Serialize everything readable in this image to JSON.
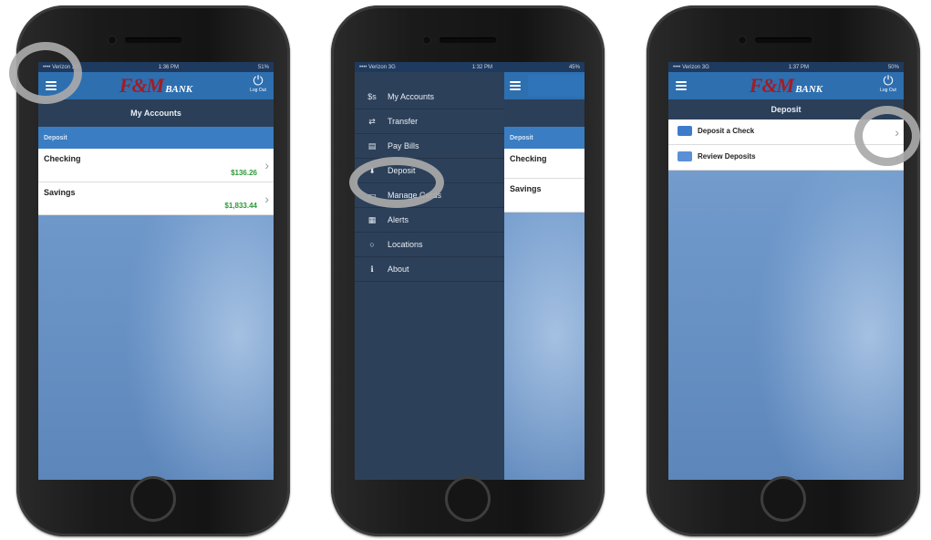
{
  "phone1": {
    "status": {
      "carrier": "•••• Verizon 3G",
      "time": "1:36 PM",
      "battery": "51%"
    },
    "header": {
      "logo_fm": "F&M",
      "logo_bank": "BANK",
      "logout_label": "Log Out"
    },
    "subheader": "My Accounts",
    "section": "Deposit",
    "accounts": [
      {
        "name": "Checking",
        "amount": "$136.26"
      },
      {
        "name": "Savings",
        "amount": "$1,833.44"
      }
    ]
  },
  "phone2": {
    "status": {
      "carrier": "•••• Verizon 3G",
      "time": "1:32 PM",
      "battery": "45%"
    },
    "menu": [
      {
        "icon": "$s",
        "label": "My Accounts"
      },
      {
        "icon": "⇄",
        "label": "Transfer"
      },
      {
        "icon": "▤",
        "label": "Pay Bills"
      },
      {
        "icon": "⬇",
        "label": "Deposit"
      },
      {
        "icon": "▭",
        "label": "Manage Cards"
      },
      {
        "icon": "▦",
        "label": "Alerts"
      },
      {
        "icon": "○",
        "label": "Locations"
      },
      {
        "icon": "ℹ",
        "label": "About"
      }
    ],
    "peek": {
      "section": "Deposit",
      "accounts": [
        "Checking",
        "Savings"
      ]
    }
  },
  "phone3": {
    "status": {
      "carrier": "•••• Verizon 3G",
      "time": "1:37 PM",
      "battery": "50%"
    },
    "header": {
      "logo_fm": "F&M",
      "logo_bank": "BANK",
      "logout_label": "Log Out"
    },
    "subheader": "Deposit",
    "options": [
      {
        "label": "Deposit a Check"
      },
      {
        "label": "Review Deposits"
      }
    ]
  },
  "colors": {
    "header_blue": "#2e6fb0",
    "section_blue": "#3a7dc2",
    "drawer": "#2c4059",
    "amount_green": "#2e9a3a",
    "logo_red": "#a11d24",
    "highlight_ring": "#a9a9a9"
  }
}
